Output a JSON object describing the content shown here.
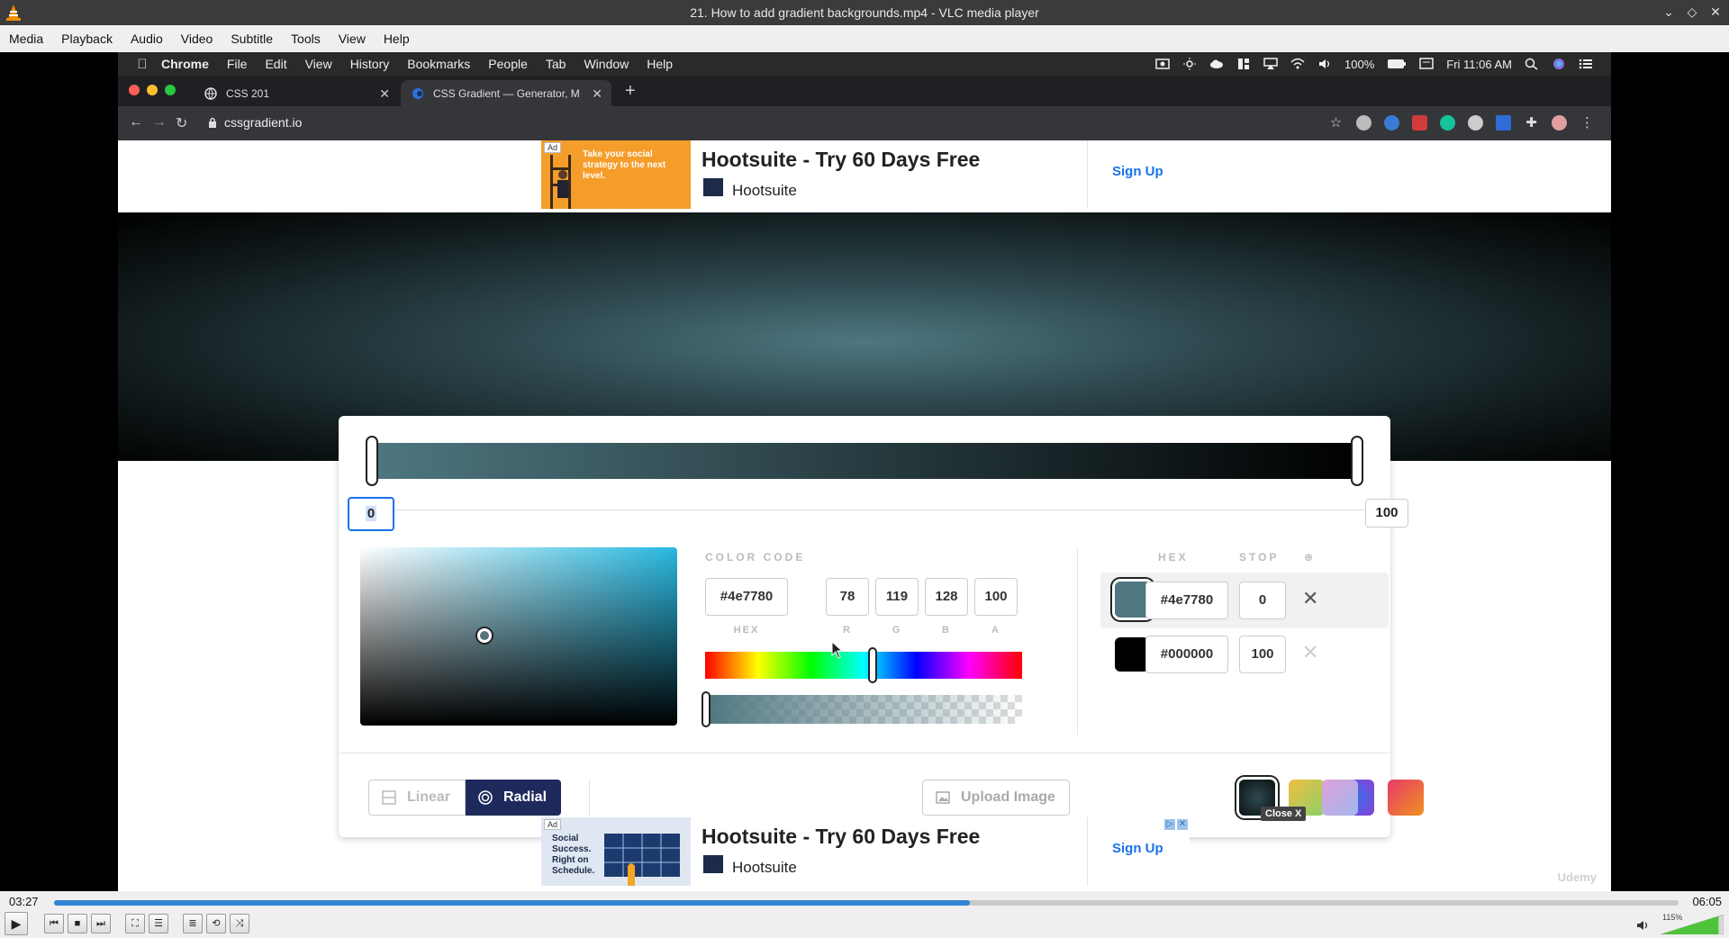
{
  "window": {
    "title": "21. How to add gradient backgrounds.mp4 - VLC media player"
  },
  "menu": [
    "Media",
    "Playback",
    "Audio",
    "Video",
    "Subtitle",
    "Tools",
    "View",
    "Help"
  ],
  "mac_menu": {
    "app": "Chrome",
    "items": [
      "File",
      "Edit",
      "View",
      "History",
      "Bookmarks",
      "People",
      "Tab",
      "Window",
      "Help"
    ],
    "battery": "100%",
    "clock": "Fri 11:06 AM"
  },
  "chrome": {
    "tabs": [
      {
        "label": "CSS 201"
      },
      {
        "label": "CSS Gradient — Generator, M"
      }
    ],
    "url": "cssgradient.io"
  },
  "ad_top": {
    "badge": "Ad",
    "image_text": "Take your social strategy to the next level.",
    "title": "Hootsuite - Try 60 Days Free",
    "brand": "Hootsuite",
    "cta": "Sign Up"
  },
  "gradient": {
    "color_start": "#4e7780",
    "color_end": "#000000",
    "stop_left": "0",
    "stop_right": "100"
  },
  "color_code": {
    "label": "COLOR CODE",
    "hex": "#4e7780",
    "r": "78",
    "g": "119",
    "b": "128",
    "a": "100",
    "labels": {
      "hex": "HEX",
      "r": "R",
      "g": "G",
      "b": "B",
      "a": "A"
    }
  },
  "stops_table": {
    "head_hex": "HEX",
    "head_stop": "STOP",
    "head_extra": "⊕",
    "rows": [
      {
        "hex": "#4e7780",
        "stop": "0",
        "color": "#4e7780"
      },
      {
        "hex": "#000000",
        "stop": "100",
        "color": "#000000"
      }
    ]
  },
  "bottom_controls": {
    "linear": "Linear",
    "radial": "Radial",
    "upload": "Upload Image",
    "tooltip": "Close X",
    "presets": [
      "#1c2b30",
      "#e8c245",
      "#6a3fd6",
      "#e84545",
      "#b99ae6"
    ]
  },
  "ad_bottom": {
    "badge": "Ad",
    "image_text": "Social Success. Right on Schedule.",
    "title": "Hootsuite - Try 60 Days Free",
    "brand": "Hootsuite",
    "cta": "Sign Up"
  },
  "watermark": "Udemy",
  "player": {
    "time_elapsed": "03:27",
    "time_total": "06:05",
    "progress": 0.564,
    "volume_label": "115%",
    "volume": 1.15,
    "accent": "#2f84d4"
  }
}
